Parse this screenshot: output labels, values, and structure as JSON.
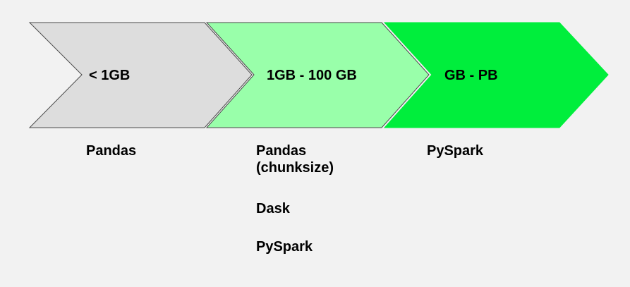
{
  "stages": [
    {
      "label": "< 1GB",
      "fill": "#dddddd",
      "stroke": "#4a4a4a"
    },
    {
      "label": "1GB - 100 GB",
      "fill": "#99ffaa",
      "stroke": "#4a4a4a"
    },
    {
      "label": "GB - PB",
      "fill": "#00ee3c",
      "stroke": "#00ee3c"
    }
  ],
  "tools": [
    [
      "Pandas"
    ],
    [
      "Pandas\n(chunksize)",
      "Dask",
      "PySpark"
    ],
    [
      "PySpark"
    ]
  ]
}
